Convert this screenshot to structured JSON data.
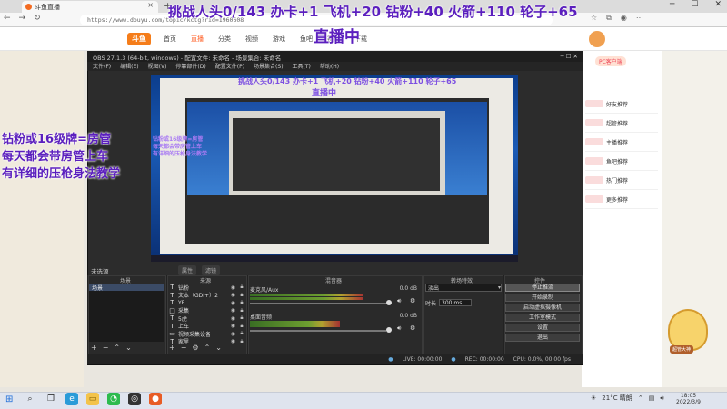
{
  "browser": {
    "tab_title": "斗鱼直播",
    "tab_close": "×",
    "new_tab": "+",
    "win_controls": [
      "─",
      "☐",
      "✕"
    ],
    "nav": [
      "←",
      "→",
      "↻"
    ],
    "url": "https://www.douyu.com/topic/kctg?rid=1960608"
  },
  "site": {
    "logo": "斗鱼",
    "nav": [
      "首页",
      "直播",
      "分类",
      "视频",
      "游戏",
      "鱼吧",
      "赛事",
      "下载"
    ],
    "pc_badge": "PC客户端"
  },
  "overlay": {
    "top_caption": "挑战人头0/143 办卡+1 飞机+20 钻粉+40 火箭+110 轮子+65",
    "live_title": "直播中",
    "left_caption_lines": [
      "钻粉或16级牌=房管",
      "每天都会带房管上车",
      "有详细的压枪身法教学"
    ]
  },
  "preview_overlay": {
    "line1": "挑战人头0/143 办卡+1 飞机+20 钻粉+40 火箭+110 轮子+65",
    "line2": "直播中",
    "side_lines": [
      "钻粉或16级牌=房管",
      "每天都会带房管上车",
      "有详细的压枪身法教学"
    ]
  },
  "obs": {
    "title": "OBS 27.1.3 (64-bit, windows) - 配置文件: 未命名 - 场景集合: 未命名",
    "menu": [
      "文件(F)",
      "编辑(E)",
      "视图(V)",
      "停靠部件(D)",
      "配置文件(P)",
      "场景集合(S)",
      "工具(T)",
      "帮助(H)"
    ],
    "no_source_selected": "未选源",
    "filter_buttons": [
      "属性",
      "滤镜"
    ],
    "docks": {
      "scenes": "场景",
      "sources": "来源",
      "mixer": "混音器",
      "transitions": "转场特效",
      "controls": "控件"
    },
    "scenes": [
      "场景"
    ],
    "sources": [
      {
        "icon": "T",
        "name": "钻粉"
      },
      {
        "icon": "T",
        "name": "文本（GDI+）2"
      },
      {
        "icon": "T",
        "name": "YE"
      },
      {
        "icon": "□",
        "name": "采集"
      },
      {
        "icon": "T",
        "name": "5虎"
      },
      {
        "icon": "T",
        "name": "上车"
      },
      {
        "icon": "▭",
        "name": "视频采集设备"
      },
      {
        "icon": "T",
        "name": "家里"
      }
    ],
    "mixer": [
      {
        "name": "麦克风/Aux",
        "db": "0.0 dB",
        "level": 0.78
      },
      {
        "name": "桌面音频",
        "db": "0.0 dB",
        "level": 0.62
      }
    ],
    "transition": {
      "type": "淡出",
      "duration_label": "时长",
      "duration": "300 ms"
    },
    "controls": [
      "停止推流",
      "开始录制",
      "启动虚拟摄像机",
      "工作室模式",
      "设置",
      "退出"
    ],
    "status": {
      "live": "LIVE: 00:00:00",
      "rec": "REC: 00:00:00",
      "cpu": "CPU: 0.0%, 00.00 fps"
    }
  },
  "recommend": {
    "items": [
      "好友推荐",
      "超管推荐",
      "主播推荐",
      "鱼吧推荐",
      "热门推荐",
      "更多推荐"
    ]
  },
  "mascot_label": "超管大神",
  "taskbar": {
    "start": "⊞",
    "tray": "21°C 晴朗",
    "clock_time": "18:05",
    "clock_date": "2022/3/9"
  }
}
